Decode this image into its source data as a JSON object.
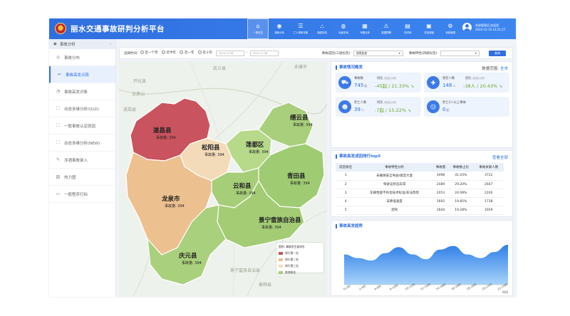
{
  "app": {
    "title": "丽水交通事故研判分析平台"
  },
  "nav": [
    {
      "label": "一屏总览",
      "icon": "home-icon",
      "glyph": "⌂"
    },
    {
      "label": "事故分析",
      "icon": "location-icon",
      "glyph": "◉"
    },
    {
      "label": "亡人事故专题",
      "icon": "list-icon",
      "glyph": "☰"
    },
    {
      "label": "隐患排查",
      "icon": "nodes-icon",
      "glyph": "⛬"
    },
    {
      "label": "轨迹查询",
      "icon": "globe-icon",
      "glyph": "◍"
    },
    {
      "label": "专题分析",
      "icon": "grid-icon",
      "glyph": "▦"
    },
    {
      "label": "数据预警",
      "icon": "warning-icon",
      "glyph": "⚠"
    },
    {
      "label": "知识库",
      "icon": "book-icon",
      "glyph": "▤"
    },
    {
      "label": "任务调度",
      "icon": "task-icon",
      "glyph": "▣"
    },
    {
      "label": "系统管理",
      "icon": "gear-icon",
      "glyph": "⚙"
    }
  ],
  "user": {
    "line1": "系统管理员,欢迎您",
    "line2": "2024-12-10 14:21:27"
  },
  "sidebar": {
    "header": "事故分析",
    "collapse": "‹",
    "items": [
      {
        "label": "事故分布",
        "icon": "pin-icon",
        "glyph": "◎"
      },
      {
        "label": "事故高发点段",
        "icon": "curve-icon",
        "glyph": "↩",
        "active": true
      },
      {
        "label": "事故高发对象",
        "icon": "object-icon",
        "glyph": "◔"
      },
      {
        "label": "动态多维分析(OLD)",
        "icon": "frame-icon",
        "glyph": "⛶"
      },
      {
        "label": "一般事故认定原因",
        "icon": "frame-icon",
        "glyph": "⛶"
      },
      {
        "label": "动态多维分析(NEW)",
        "icon": "frame-icon",
        "glyph": "⛶"
      },
      {
        "label": "涉酒事故录入",
        "icon": "edit-icon",
        "glyph": "✎"
      },
      {
        "label": "热力图",
        "icon": "image-icon",
        "glyph": "▨"
      },
      {
        "label": "一般程序打标",
        "icon": "doc-icon",
        "glyph": "▭"
      }
    ]
  },
  "filters": {
    "time_label": "选择时间:",
    "options": [
      "近一个月",
      "近半年",
      "近一年",
      "近十年"
    ],
    "start_placeholder": "2024-11-08",
    "end_placeholder": "2024-11-08",
    "cause_label": "事故成因(三级标签):",
    "cause_value": "违规变道",
    "feature_label": "事故特性(四级标签):",
    "feature_value": "",
    "query": "查询"
  },
  "map": {
    "labels": {
      "outer1": "武义县",
      "outer2": "永康市",
      "outer3": "泰顺县",
      "outer4": "景宁畲族自治县",
      "outer5": "开化县",
      "outer6": "龙泉山",
      "outer7": "遂昌县"
    },
    "regions": [
      {
        "name": "遂昌县",
        "stat": "事故量: 394",
        "color": "#c9535e"
      },
      {
        "name": "松阳县",
        "stat": "事故量: 394",
        "color": "#f3dbb9"
      },
      {
        "name": "莲都区",
        "stat": "事故量: 394",
        "color": "#b7d98a"
      },
      {
        "name": "缙云县",
        "stat": "事故量: 394",
        "color": "#a9cf7c"
      },
      {
        "name": "青田县",
        "stat": "事故量: 394",
        "color": "#9fcb72"
      },
      {
        "name": "云和县",
        "stat": "事故量: 394",
        "color": "#a6cd78"
      },
      {
        "name": "龙泉市",
        "stat": "事故量: 394",
        "color": "#edc08f"
      },
      {
        "name": "景宁畲族自治县",
        "stat": "事故量: 394",
        "color": "#a3cc75"
      },
      {
        "name": "庆元县",
        "stat": "事故量: 394",
        "color": "#a9d07c"
      }
    ],
    "legend": {
      "title": "图例: 事故发生量排名",
      "items": [
        {
          "label": "排行第一名",
          "color": "#c9535e"
        },
        {
          "label": "排行第二名",
          "color": "#edc08f"
        },
        {
          "label": "排行第三名",
          "color": "#f3dbb9"
        },
        {
          "label": "其他排名",
          "color": "#a6cd78"
        }
      ]
    }
  },
  "overview": {
    "title": "事故情况概览",
    "scope_label": "数据范围:",
    "scope_value": "全市",
    "cards": [
      {
        "label": "事故数",
        "value": "745",
        "unit": "起",
        "yoy_label": "同比",
        "yoy_hint": "(数量/比例)",
        "yoy_value": "-45起 / 21.33%",
        "icon": "car-accident-icon",
        "glyph": "⛟"
      },
      {
        "label": "受伤人数",
        "value": "148",
        "unit": "人",
        "yoy_label": "同比",
        "yoy_hint": "(数量/比例)",
        "yoy_value": "-38人 / 20.43%",
        "icon": "injury-icon",
        "glyph": "✚"
      },
      {
        "label": "死亡人数",
        "value": "39",
        "unit": "人",
        "yoy_label": "同比",
        "yoy_hint": "(数量/比例)",
        "yoy_value": "-7起 / 15.22%",
        "icon": "death-icon",
        "glyph": "☻"
      },
      {
        "label": "死亡2人以上事故",
        "value": "0",
        "unit": "起",
        "yoy_label": "",
        "yoy_hint": "",
        "yoy_value": "",
        "icon": "multi-death-icon",
        "glyph": "☹"
      }
    ]
  },
  "ranking": {
    "title": "事故高发成因排行top5",
    "link": "查看全部",
    "headers": [
      "成因排名",
      "事故特性分析",
      "事故量",
      "事故数占比",
      "事故关联人数"
    ],
    "rows": [
      [
        "1",
        "未确保安全驾驶/疏忽大意",
        "3498",
        "41.03%",
        "3722"
      ],
      [
        "2",
        "驾驶证状态异常",
        "2489",
        "29.20%",
        "2647"
      ],
      [
        "3",
        "车辆性能不符合技术标准/非法改装",
        "2053",
        "24.08%",
        "2240"
      ],
      [
        "4",
        "未降低速度",
        "1692",
        "19.85%",
        "1738"
      ],
      [
        "5",
        "酒驾",
        "1644",
        "19.28%",
        "1659"
      ]
    ]
  },
  "trend": {
    "title": "事故高发趋势",
    "xlabels": [
      "0-2时",
      "2-4时",
      "4-6时",
      "8-10时",
      "10-12时",
      "12-14时",
      "14-16时",
      "16-18时",
      "18-20时",
      "20-22时",
      "22-24时"
    ],
    "xunit": "时间",
    "values": [
      50,
      44,
      40,
      52,
      62,
      50,
      42,
      58,
      64,
      50,
      44,
      54,
      66
    ]
  },
  "colors": {
    "accent": "#2f6ee0",
    "down": "#6aa52a"
  }
}
